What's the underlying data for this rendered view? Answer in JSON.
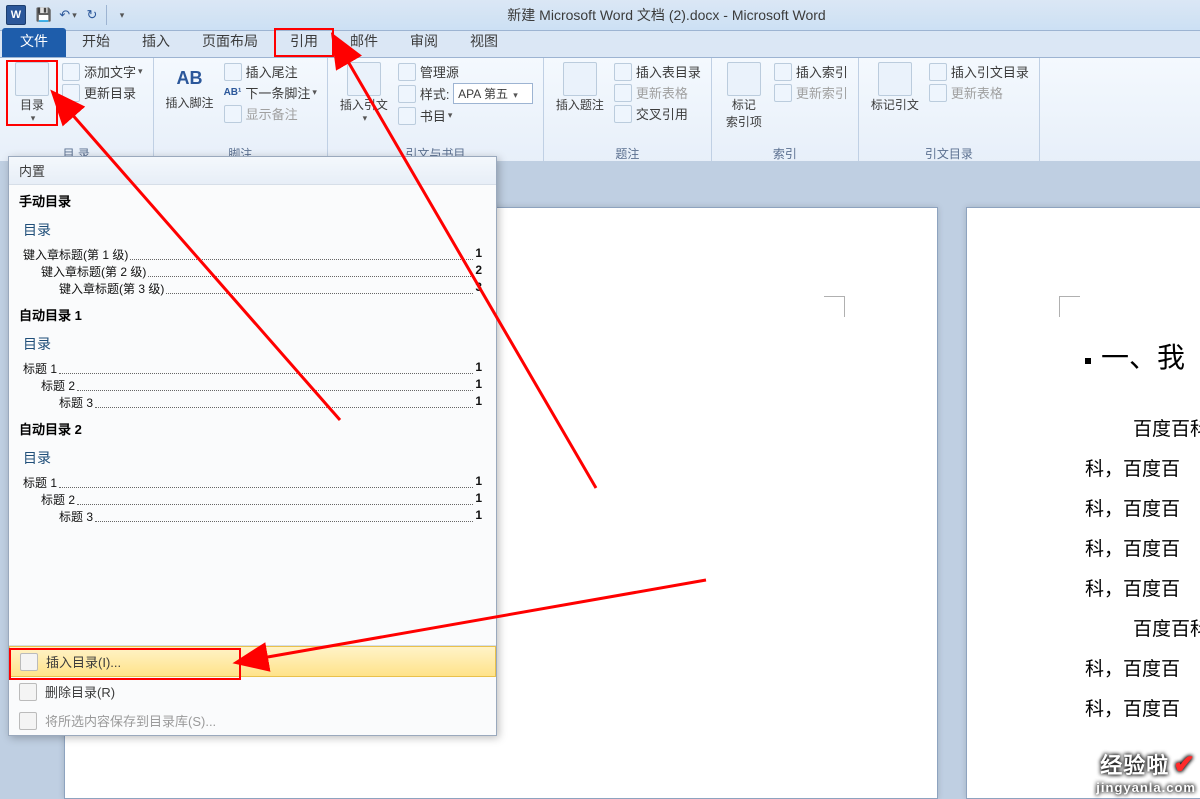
{
  "window": {
    "title": "新建 Microsoft Word 文档 (2).docx - Microsoft Word",
    "app_letter": "W"
  },
  "tabs": {
    "file": "文件",
    "items": [
      "开始",
      "插入",
      "页面布局",
      "引用",
      "邮件",
      "审阅",
      "视图"
    ]
  },
  "ribbon": {
    "toc": {
      "big": "目录",
      "add_text": "添加文字",
      "update": "更新目录",
      "group": "目 录"
    },
    "footnotes": {
      "insert_footnote": "插入脚注",
      "insert_endnote": "插入尾注",
      "next": "下一条脚注",
      "show_notes": "显示备注",
      "ab_label": "AB",
      "group": "脚注"
    },
    "citations": {
      "insert_citation": "插入引文",
      "manage_sources": "管理源",
      "style_label": "样式:",
      "style_value": "APA 第五",
      "biblio": "书目",
      "group": "引文与书目"
    },
    "captions": {
      "insert_caption": "插入题注",
      "insert_tof": "插入表目录",
      "update_tof": "更新表格",
      "cross_ref": "交叉引用",
      "group": "题注"
    },
    "index": {
      "mark": "标记\n索引项",
      "insert_index": "插入索引",
      "update_index": "更新索引",
      "group": "索引"
    },
    "toa": {
      "mark_citation": "标记引文",
      "insert_toa": "插入引文目录",
      "update_toa": "更新表格",
      "group": "引文目录"
    }
  },
  "dropdown": {
    "builtin": "内置",
    "manual": {
      "caption": "手动目录",
      "title": "目录",
      "lines": [
        {
          "text": "键入章标题(第 1 级)",
          "page": "1",
          "indent": 0
        },
        {
          "text": "键入章标题(第 2 级)",
          "page": "2",
          "indent": 1
        },
        {
          "text": "键入章标题(第 3 级)",
          "page": "3",
          "indent": 2
        }
      ]
    },
    "auto1": {
      "caption": "自动目录 1",
      "title": "目录",
      "lines": [
        {
          "text": "标题 1",
          "page": "1",
          "indent": 0
        },
        {
          "text": "标题 2",
          "page": "1",
          "indent": 1
        },
        {
          "text": "标题 3",
          "page": "1",
          "indent": 2
        }
      ]
    },
    "auto2": {
      "caption": "自动目录 2",
      "title": "目录",
      "lines": [
        {
          "text": "标题 1",
          "page": "1",
          "indent": 0
        },
        {
          "text": "标题 2",
          "page": "1",
          "indent": 1
        },
        {
          "text": "标题 3",
          "page": "1",
          "indent": 2
        }
      ]
    },
    "insert_toc": "插入目录(I)...",
    "remove_toc": "删除目录(R)",
    "save_to_gallery": "将所选内容保存到目录库(S)..."
  },
  "page2": {
    "heading": "一、我",
    "lines": [
      "百度百科",
      "科，百度百",
      "科，百度百",
      "科，百度百",
      "科，百度百",
      "百度百科",
      "科，百度百",
      "科，百度百"
    ]
  },
  "watermark": {
    "top": "经验啦",
    "bottom": "jingyanla.com"
  }
}
